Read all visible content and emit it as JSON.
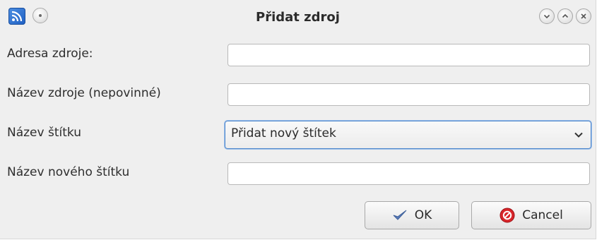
{
  "window": {
    "title": "Přidat zdroj"
  },
  "titlebar": {
    "app_icon": "rss-feed-icon",
    "menu_icon": "window-menu-icon",
    "buttons": [
      "minimize-icon",
      "maximize-icon",
      "close-icon"
    ]
  },
  "form": {
    "source_address_label": "Adresa zdroje:",
    "source_address_value": "",
    "source_name_label": "Název zdroje (nepovinné)",
    "source_name_value": "",
    "tag_name_label": "Název štítku",
    "tag_name_selected": "Přidat nový štítek",
    "new_tag_name_label": "Název nového štítku",
    "new_tag_name_value": ""
  },
  "buttons": {
    "ok_label": "OK",
    "ok_icon": "checkmark-icon",
    "cancel_label": "Cancel",
    "cancel_icon": "cancel-circle-icon"
  },
  "colors": {
    "focus_border": "#4d86cc",
    "ok_icon": "#5a7bb8",
    "cancel_icon": "#d8262b"
  }
}
